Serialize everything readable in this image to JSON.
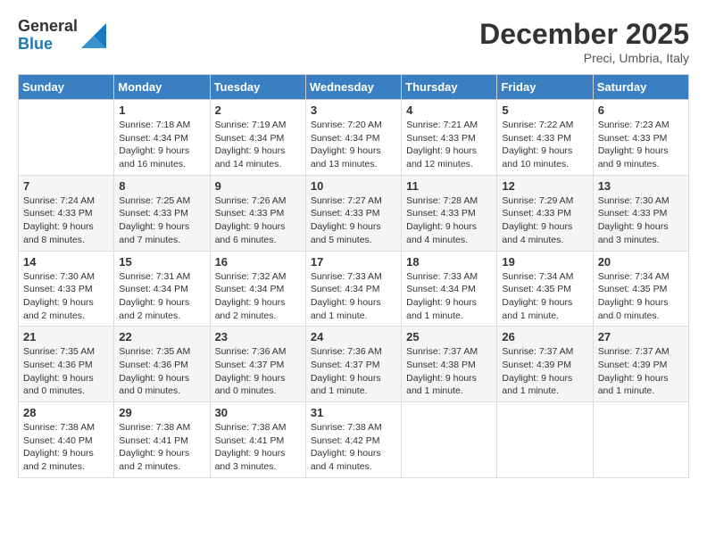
{
  "logo": {
    "general": "General",
    "blue": "Blue"
  },
  "header": {
    "month": "December 2025",
    "location": "Preci, Umbria, Italy"
  },
  "weekdays": [
    "Sunday",
    "Monday",
    "Tuesday",
    "Wednesday",
    "Thursday",
    "Friday",
    "Saturday"
  ],
  "weeks": [
    [
      {
        "day": "",
        "info": ""
      },
      {
        "day": "1",
        "info": "Sunrise: 7:18 AM\nSunset: 4:34 PM\nDaylight: 9 hours\nand 16 minutes."
      },
      {
        "day": "2",
        "info": "Sunrise: 7:19 AM\nSunset: 4:34 PM\nDaylight: 9 hours\nand 14 minutes."
      },
      {
        "day": "3",
        "info": "Sunrise: 7:20 AM\nSunset: 4:34 PM\nDaylight: 9 hours\nand 13 minutes."
      },
      {
        "day": "4",
        "info": "Sunrise: 7:21 AM\nSunset: 4:33 PM\nDaylight: 9 hours\nand 12 minutes."
      },
      {
        "day": "5",
        "info": "Sunrise: 7:22 AM\nSunset: 4:33 PM\nDaylight: 9 hours\nand 10 minutes."
      },
      {
        "day": "6",
        "info": "Sunrise: 7:23 AM\nSunset: 4:33 PM\nDaylight: 9 hours\nand 9 minutes."
      }
    ],
    [
      {
        "day": "7",
        "info": "Sunrise: 7:24 AM\nSunset: 4:33 PM\nDaylight: 9 hours\nand 8 minutes."
      },
      {
        "day": "8",
        "info": "Sunrise: 7:25 AM\nSunset: 4:33 PM\nDaylight: 9 hours\nand 7 minutes."
      },
      {
        "day": "9",
        "info": "Sunrise: 7:26 AM\nSunset: 4:33 PM\nDaylight: 9 hours\nand 6 minutes."
      },
      {
        "day": "10",
        "info": "Sunrise: 7:27 AM\nSunset: 4:33 PM\nDaylight: 9 hours\nand 5 minutes."
      },
      {
        "day": "11",
        "info": "Sunrise: 7:28 AM\nSunset: 4:33 PM\nDaylight: 9 hours\nand 4 minutes."
      },
      {
        "day": "12",
        "info": "Sunrise: 7:29 AM\nSunset: 4:33 PM\nDaylight: 9 hours\nand 4 minutes."
      },
      {
        "day": "13",
        "info": "Sunrise: 7:30 AM\nSunset: 4:33 PM\nDaylight: 9 hours\nand 3 minutes."
      }
    ],
    [
      {
        "day": "14",
        "info": "Sunrise: 7:30 AM\nSunset: 4:33 PM\nDaylight: 9 hours\nand 2 minutes."
      },
      {
        "day": "15",
        "info": "Sunrise: 7:31 AM\nSunset: 4:34 PM\nDaylight: 9 hours\nand 2 minutes."
      },
      {
        "day": "16",
        "info": "Sunrise: 7:32 AM\nSunset: 4:34 PM\nDaylight: 9 hours\nand 2 minutes."
      },
      {
        "day": "17",
        "info": "Sunrise: 7:33 AM\nSunset: 4:34 PM\nDaylight: 9 hours\nand 1 minute."
      },
      {
        "day": "18",
        "info": "Sunrise: 7:33 AM\nSunset: 4:34 PM\nDaylight: 9 hours\nand 1 minute."
      },
      {
        "day": "19",
        "info": "Sunrise: 7:34 AM\nSunset: 4:35 PM\nDaylight: 9 hours\nand 1 minute."
      },
      {
        "day": "20",
        "info": "Sunrise: 7:34 AM\nSunset: 4:35 PM\nDaylight: 9 hours\nand 0 minutes."
      }
    ],
    [
      {
        "day": "21",
        "info": "Sunrise: 7:35 AM\nSunset: 4:36 PM\nDaylight: 9 hours\nand 0 minutes."
      },
      {
        "day": "22",
        "info": "Sunrise: 7:35 AM\nSunset: 4:36 PM\nDaylight: 9 hours\nand 0 minutes."
      },
      {
        "day": "23",
        "info": "Sunrise: 7:36 AM\nSunset: 4:37 PM\nDaylight: 9 hours\nand 0 minutes."
      },
      {
        "day": "24",
        "info": "Sunrise: 7:36 AM\nSunset: 4:37 PM\nDaylight: 9 hours\nand 1 minute."
      },
      {
        "day": "25",
        "info": "Sunrise: 7:37 AM\nSunset: 4:38 PM\nDaylight: 9 hours\nand 1 minute."
      },
      {
        "day": "26",
        "info": "Sunrise: 7:37 AM\nSunset: 4:39 PM\nDaylight: 9 hours\nand 1 minute."
      },
      {
        "day": "27",
        "info": "Sunrise: 7:37 AM\nSunset: 4:39 PM\nDaylight: 9 hours\nand 1 minute."
      }
    ],
    [
      {
        "day": "28",
        "info": "Sunrise: 7:38 AM\nSunset: 4:40 PM\nDaylight: 9 hours\nand 2 minutes."
      },
      {
        "day": "29",
        "info": "Sunrise: 7:38 AM\nSunset: 4:41 PM\nDaylight: 9 hours\nand 2 minutes."
      },
      {
        "day": "30",
        "info": "Sunrise: 7:38 AM\nSunset: 4:41 PM\nDaylight: 9 hours\nand 3 minutes."
      },
      {
        "day": "31",
        "info": "Sunrise: 7:38 AM\nSunset: 4:42 PM\nDaylight: 9 hours\nand 4 minutes."
      },
      {
        "day": "",
        "info": ""
      },
      {
        "day": "",
        "info": ""
      },
      {
        "day": "",
        "info": ""
      }
    ]
  ]
}
